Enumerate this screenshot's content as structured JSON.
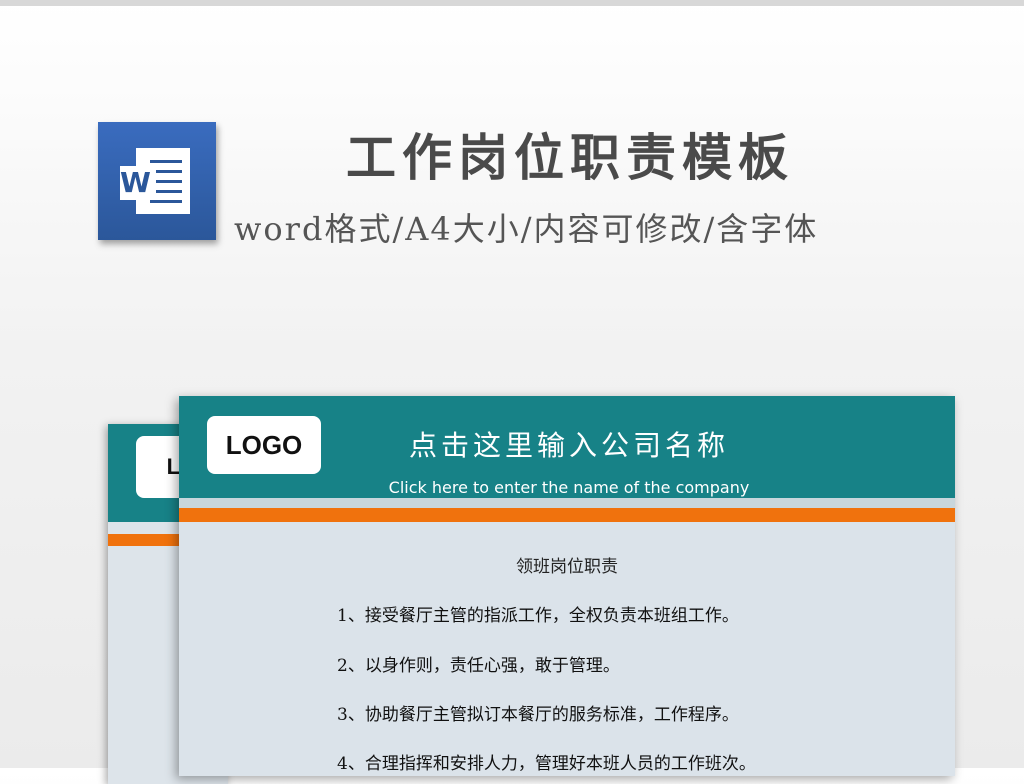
{
  "header": {
    "title": "工作岗位职责模板",
    "subtitle": "word格式/A4大小/内容可修改/含字体"
  },
  "word_icon": {
    "letter": "W",
    "icon": "word-icon",
    "color": "#2b579a"
  },
  "document": {
    "logo_text": "LOGO",
    "company_name_cn": "点击这里输入公司名称",
    "company_name_en": "Click here to enter the name of the company",
    "doc_title": "领班岗位职责",
    "duties": [
      "1、接受餐厅主管的指派工作，全权负责本班组工作。",
      "2、以身作则，责任心强，敢于管理。",
      "3、协助餐厅主管拟订本餐厅的服务标准，工作程序。",
      "4、合理指挥和安排人力，管理好本班人员的工作班次。"
    ],
    "colors": {
      "band": "#178287",
      "stripe": "#f0720d",
      "paper": "#dbe3ea"
    }
  },
  "back_page": {
    "logo_text": "LOGO"
  }
}
